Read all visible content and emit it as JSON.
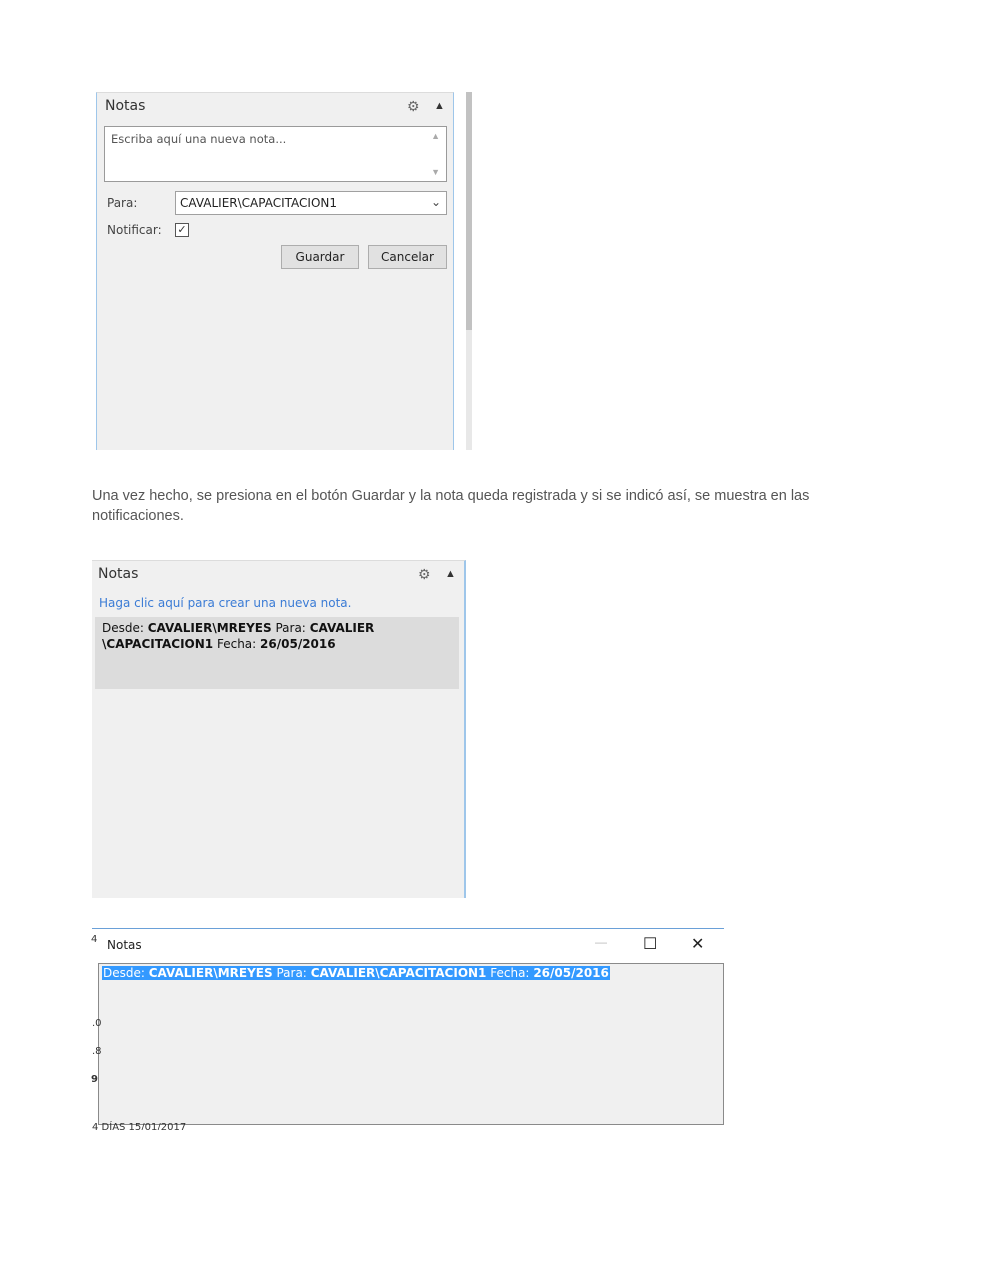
{
  "panel1": {
    "title": "Notas",
    "gear_icon": "gear-icon",
    "collapse_icon": "chevron-up-icon",
    "textarea_placeholder": "Escriba aquí una nueva nota...",
    "para_label": "Para:",
    "para_value": "CAVALIER\\CAPACITACION1",
    "notify_label": "Notificar:",
    "notify_checked": "✓",
    "save_label": "Guardar",
    "cancel_label": "Cancelar"
  },
  "paragraph": "Una vez hecho, se presiona en el botón Guardar y la nota queda registrada y si se indicó así, se muestra en las notificaciones.",
  "panel2": {
    "title": "Notas",
    "create_link": "Haga clic aquí para crear una nueva nota.",
    "note": {
      "desde_label": "Desde:",
      "desde_value": "CAVALIER\\MREYES",
      "para_label": "Para:",
      "para_value_line1": "CAVALIER",
      "para_value_line2": "\\CAPACITACION1",
      "fecha_label": "Fecha:",
      "fecha_value": "26/05/2016"
    }
  },
  "window3": {
    "title": "Notas",
    "minimize": "—",
    "maximize": "☐",
    "close": "✕",
    "selected_line": {
      "desde_label": "Desde:",
      "desde_value": "CAVALIER\\MREYES",
      "para_label": "Para:",
      "para_value": "CAVALIER\\CAPACITACION1",
      "fecha_label": "Fecha:",
      "fecha_value": "26/05/2016"
    },
    "left_fragments": [
      "4",
      ".0",
      ".8",
      "9"
    ],
    "bottom_fragment": "4 DÍAS   15/01/2017"
  }
}
